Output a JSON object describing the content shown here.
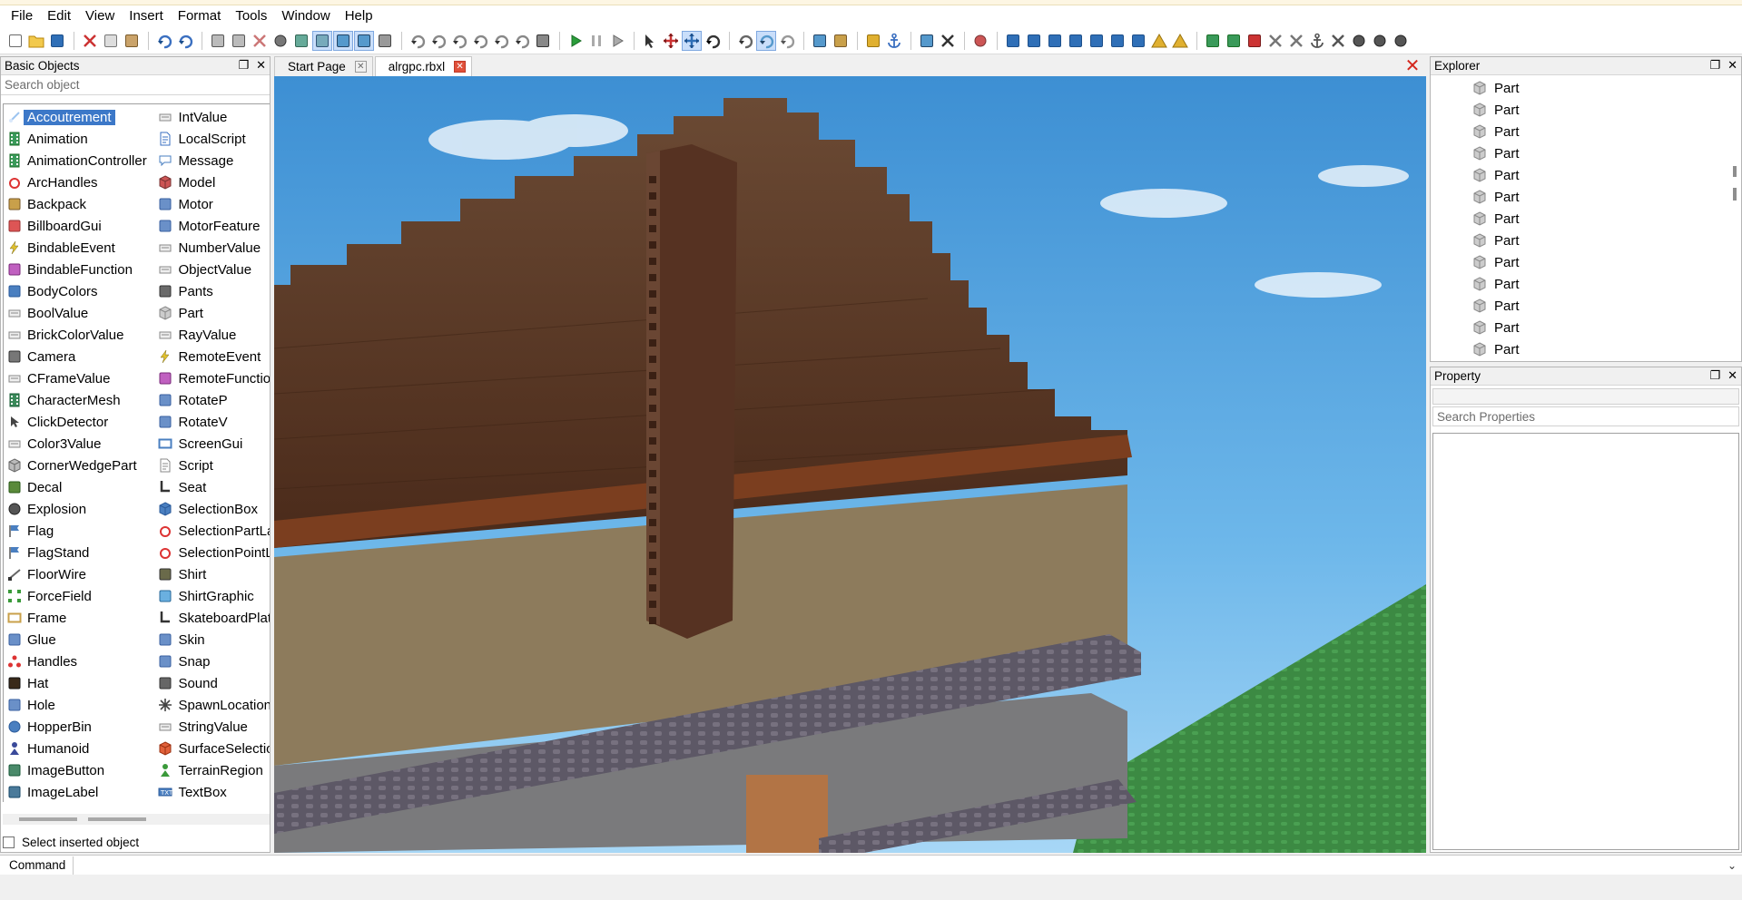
{
  "menu": [
    "File",
    "Edit",
    "View",
    "Insert",
    "Format",
    "Tools",
    "Window",
    "Help"
  ],
  "left_panel": {
    "title": "Basic Objects",
    "search_placeholder": "Search object",
    "selected": "Accoutrement",
    "column1": [
      {
        "label": "Accoutrement",
        "icon": "accoutrement-icon"
      },
      {
        "label": "Animation",
        "icon": "animation-icon"
      },
      {
        "label": "AnimationController",
        "icon": "animation-controller-icon"
      },
      {
        "label": "ArcHandles",
        "icon": "arc-handles-icon"
      },
      {
        "label": "Backpack",
        "icon": "backpack-icon"
      },
      {
        "label": "BillboardGui",
        "icon": "billboard-gui-icon"
      },
      {
        "label": "BindableEvent",
        "icon": "bindable-event-icon"
      },
      {
        "label": "BindableFunction",
        "icon": "bindable-function-icon"
      },
      {
        "label": "BodyColors",
        "icon": "body-colors-icon"
      },
      {
        "label": "BoolValue",
        "icon": "value-icon"
      },
      {
        "label": "BrickColorValue",
        "icon": "value-icon"
      },
      {
        "label": "Camera",
        "icon": "camera-icon"
      },
      {
        "label": "CFrameValue",
        "icon": "value-icon"
      },
      {
        "label": "CharacterMesh",
        "icon": "character-mesh-icon"
      },
      {
        "label": "ClickDetector",
        "icon": "click-detector-icon"
      },
      {
        "label": "Color3Value",
        "icon": "value-icon"
      },
      {
        "label": "CornerWedgePart",
        "icon": "corner-wedge-icon"
      },
      {
        "label": "Decal",
        "icon": "decal-icon"
      },
      {
        "label": "Explosion",
        "icon": "explosion-icon"
      },
      {
        "label": "Flag",
        "icon": "flag-icon"
      },
      {
        "label": "FlagStand",
        "icon": "flag-stand-icon"
      },
      {
        "label": "FloorWire",
        "icon": "floor-wire-icon"
      },
      {
        "label": "ForceField",
        "icon": "force-field-icon"
      },
      {
        "label": "Frame",
        "icon": "frame-icon"
      },
      {
        "label": "Glue",
        "icon": "joint-icon"
      },
      {
        "label": "Handles",
        "icon": "handles-icon"
      },
      {
        "label": "Hat",
        "icon": "hat-icon"
      },
      {
        "label": "Hole",
        "icon": "joint-icon"
      },
      {
        "label": "HopperBin",
        "icon": "hopper-bin-icon"
      },
      {
        "label": "Humanoid",
        "icon": "humanoid-icon"
      },
      {
        "label": "ImageButton",
        "icon": "image-button-icon"
      },
      {
        "label": "ImageLabel",
        "icon": "image-label-icon"
      }
    ],
    "column2": [
      {
        "label": "IntValue",
        "icon": "value-icon"
      },
      {
        "label": "LocalScript",
        "icon": "local-script-icon"
      },
      {
        "label": "Message",
        "icon": "message-icon"
      },
      {
        "label": "Model",
        "icon": "model-icon"
      },
      {
        "label": "Motor",
        "icon": "joint-icon"
      },
      {
        "label": "MotorFeature",
        "icon": "joint-icon"
      },
      {
        "label": "NumberValue",
        "icon": "value-icon"
      },
      {
        "label": "ObjectValue",
        "icon": "value-icon"
      },
      {
        "label": "Pants",
        "icon": "pants-icon"
      },
      {
        "label": "Part",
        "icon": "part-icon"
      },
      {
        "label": "RayValue",
        "icon": "value-icon"
      },
      {
        "label": "RemoteEvent",
        "icon": "remote-event-icon"
      },
      {
        "label": "RemoteFunction",
        "icon": "remote-function-icon"
      },
      {
        "label": "RotateP",
        "icon": "joint-icon"
      },
      {
        "label": "RotateV",
        "icon": "joint-icon"
      },
      {
        "label": "ScreenGui",
        "icon": "screen-gui-icon"
      },
      {
        "label": "Script",
        "icon": "script-icon"
      },
      {
        "label": "Seat",
        "icon": "seat-icon"
      },
      {
        "label": "SelectionBox",
        "icon": "selection-box-icon"
      },
      {
        "label": "SelectionPartLasso",
        "icon": "lasso-icon"
      },
      {
        "label": "SelectionPointLasso",
        "icon": "lasso-icon"
      },
      {
        "label": "Shirt",
        "icon": "shirt-icon"
      },
      {
        "label": "ShirtGraphic",
        "icon": "shirt-graphic-icon"
      },
      {
        "label": "SkateboardPlatform",
        "icon": "skateboard-icon"
      },
      {
        "label": "Skin",
        "icon": "joint-icon"
      },
      {
        "label": "Snap",
        "icon": "joint-icon"
      },
      {
        "label": "Sound",
        "icon": "sound-icon"
      },
      {
        "label": "SpawnLocation",
        "icon": "spawn-icon"
      },
      {
        "label": "StringValue",
        "icon": "value-icon"
      },
      {
        "label": "SurfaceSelection",
        "icon": "surface-selection-icon"
      },
      {
        "label": "TerrainRegion",
        "icon": "terrain-region-icon"
      },
      {
        "label": "TextBox",
        "icon": "textbox-icon"
      }
    ],
    "select_inserted_label": "Select inserted object"
  },
  "tabs": [
    {
      "label": "Start Page",
      "active": false
    },
    {
      "label": "alrgpc.rbxl",
      "active": true
    }
  ],
  "explorer": {
    "title": "Explorer",
    "items": [
      "Part",
      "Part",
      "Part",
      "Part",
      "Part",
      "Part",
      "Part",
      "Part",
      "Part",
      "Part",
      "Part",
      "Part",
      "Part"
    ]
  },
  "property": {
    "title": "Property",
    "search_placeholder": "Search Properties"
  },
  "command": {
    "label": "Command"
  },
  "colors": {
    "accent": "#3c78c8",
    "sky": "#4aa3dd",
    "roof": "#5a3220",
    "wall": "#8d7b5c",
    "trim": "#5e5868",
    "grass": "#3f8f45"
  }
}
